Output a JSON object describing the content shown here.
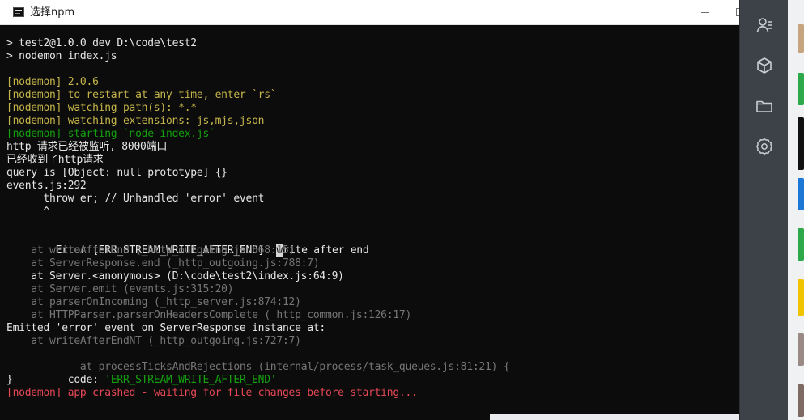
{
  "window": {
    "title": "选择npm"
  },
  "terminal": {
    "lines": [
      "> test2@1.0.0 dev D:\\code\\test2",
      "> nodemon index.js",
      "",
      "[nodemon] 2.0.6",
      "[nodemon] to restart at any time, enter `rs`",
      "[nodemon] watching path(s): *.*",
      "[nodemon] watching extensions: js,mjs,json",
      "[nodemon] starting `node index.js`",
      "http 请求已经被监听, 8000端口",
      "已经收到了http请求",
      "query is [Object: null prototype] {}",
      "events.js:292",
      "      throw er; // Unhandled 'error' event",
      "      ^",
      "",
      "Error [ERR_STREAM_WRITE_AFTER_END]: ",
      "w",
      "rite after end",
      "    at writeAfterEnd (_http_outgoing.js:668:15)",
      "    at ServerResponse.end (_http_outgoing.js:788:7)",
      "    at Server.<anonymous> (D:\\code\\test2\\index.js:64:9)",
      "    at Server.emit (events.js:315:20)",
      "    at parserOnIncoming (_http_server.js:874:12)",
      "    at HTTPParser.parserOnHeadersComplete (_http_common.js:126:17)",
      "Emitted 'error' event on ServerResponse instance at:",
      "    at writeAfterEndNT (_http_outgoing.js:727:7)",
      "    at processTicksAndRejections (internal/process/task_queues.js:81:21) {",
      "  code: ",
      "'ERR_STREAM_WRITE_AFTER_END'",
      "}",
      "[nodemon] app crashed - waiting for file changes before starting..."
    ]
  },
  "icons": {
    "app": "console-app-icon",
    "minimize": "minimize-icon",
    "maximize": "maximize-icon",
    "user": "user-icon",
    "cube": "cube-icon",
    "folder": "folder-icon",
    "settings": "settings-icon"
  },
  "colors": {
    "terminal_background": "#0c0c0c",
    "terminal_text": "#cccccc",
    "nodemon_yellow": "#c5b54a",
    "success_green": "#13a10e",
    "error_red": "#e74856",
    "muted_gray": "#767676",
    "side_rail": "#3d4148"
  }
}
